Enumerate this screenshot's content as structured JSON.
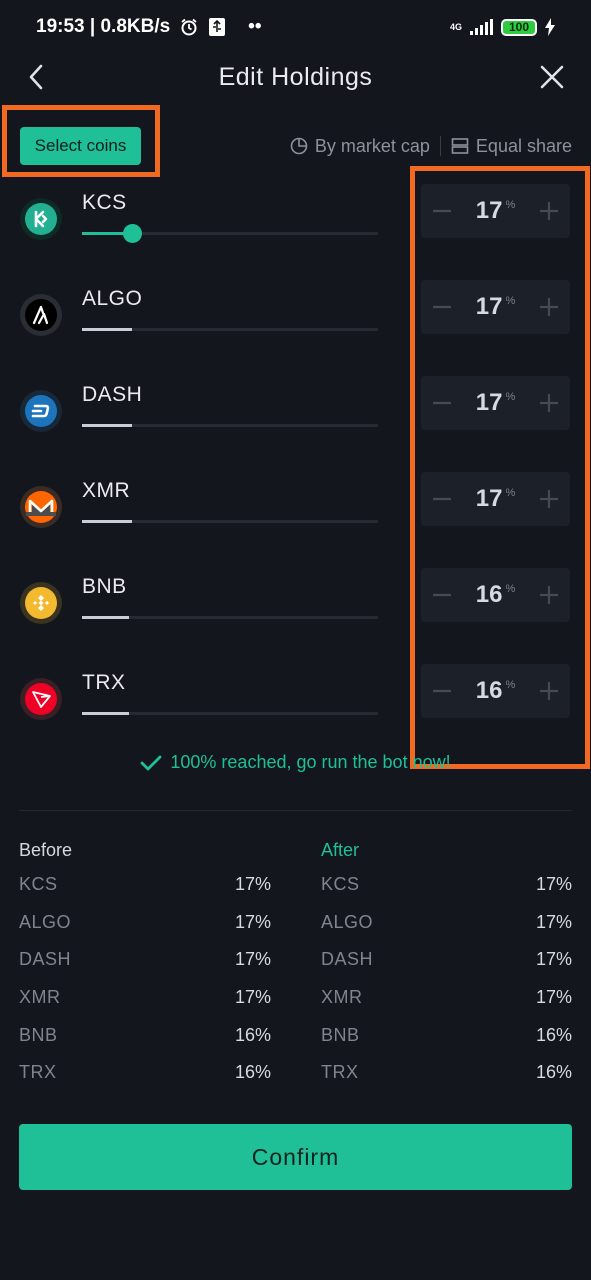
{
  "status": {
    "time_speed": "19:53 | 0.8KB/s",
    "dots": "••",
    "network": "4G",
    "battery": "100"
  },
  "header": {
    "title": "Edit Holdings"
  },
  "toolbar": {
    "select_coins": "Select coins",
    "by_market_cap": "By market cap",
    "equal_share": "Equal share"
  },
  "coins": [
    {
      "symbol": "KCS",
      "value": "17",
      "unit": "%",
      "color": "#23af91"
    },
    {
      "symbol": "ALGO",
      "value": "17",
      "unit": "%",
      "color": "#000000"
    },
    {
      "symbol": "DASH",
      "value": "17",
      "unit": "%",
      "color": "#1c75bc"
    },
    {
      "symbol": "XMR",
      "value": "17",
      "unit": "%",
      "color": "#ff6600"
    },
    {
      "symbol": "BNB",
      "value": "16",
      "unit": "%",
      "color": "#f3ba2f"
    },
    {
      "symbol": "TRX",
      "value": "16",
      "unit": "%",
      "color": "#ef0027"
    }
  ],
  "message": "100% reached, go run the bot now!",
  "before": {
    "heading": "Before",
    "rows": [
      {
        "symbol": "KCS",
        "pct": "17%"
      },
      {
        "symbol": "ALGO",
        "pct": "17%"
      },
      {
        "symbol": "DASH",
        "pct": "17%"
      },
      {
        "symbol": "XMR",
        "pct": "17%"
      },
      {
        "symbol": "BNB",
        "pct": "16%"
      },
      {
        "symbol": "TRX",
        "pct": "16%"
      }
    ]
  },
  "after": {
    "heading": "After",
    "rows": [
      {
        "symbol": "KCS",
        "pct": "17%"
      },
      {
        "symbol": "ALGO",
        "pct": "17%"
      },
      {
        "symbol": "DASH",
        "pct": "17%"
      },
      {
        "symbol": "XMR",
        "pct": "17%"
      },
      {
        "symbol": "BNB",
        "pct": "16%"
      },
      {
        "symbol": "TRX",
        "pct": "16%"
      }
    ]
  },
  "confirm_label": "Confirm",
  "colors": {
    "accent": "#1fbf98",
    "highlight": "#f26a21",
    "background": "#13161d"
  }
}
